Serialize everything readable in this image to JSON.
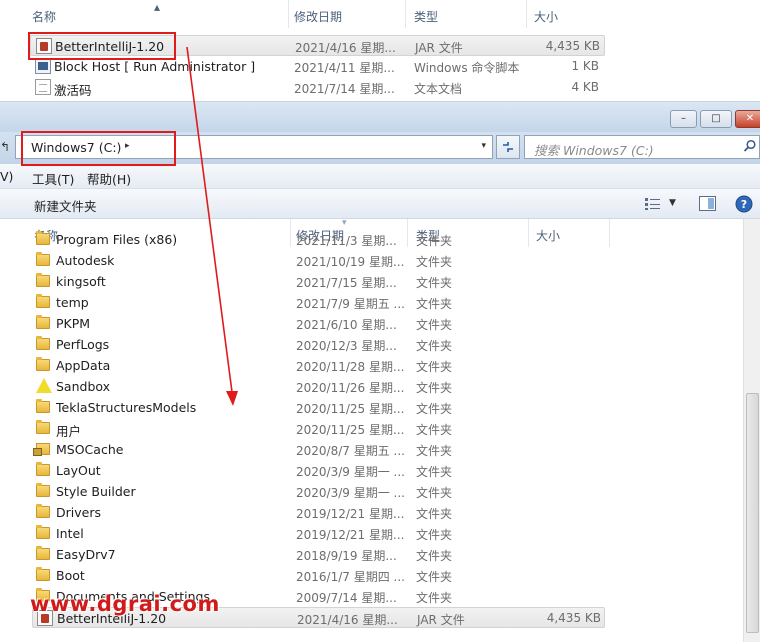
{
  "top_pane": {
    "columns": {
      "name": "名称",
      "date": "修改日期",
      "type": "类型",
      "size": "大小"
    },
    "files": [
      {
        "name": "BetterIntelliJ-1.20",
        "date": "2021/4/16 星期...",
        "type": "JAR 文件",
        "size": "4,435 KB",
        "icon": "jar-file-icon",
        "selected": true
      },
      {
        "name": "Block Host [ Run Administrator ]",
        "date": "2021/4/11 星期...",
        "type": "Windows 命令脚本",
        "size": "1 KB",
        "icon": "batch-file-icon"
      },
      {
        "name": "激活码",
        "date": "2021/7/14 星期...",
        "type": "文本文档",
        "size": "4 KB",
        "icon": "text-file-icon"
      }
    ]
  },
  "window": {
    "address": {
      "left_stub": "↰",
      "crumb": "Windows7 (C:)",
      "caret": "▸",
      "dropdown": "▾"
    },
    "refresh_icon": "refresh-icon",
    "search": {
      "placeholder": "搜索 Windows7 (C:)"
    },
    "menu": {
      "view_partial": "V)",
      "tools": "工具(T)",
      "help": "帮助(H)"
    },
    "toolbar": {
      "new_folder": "新建文件夹"
    },
    "caption_buttons": {
      "minimize": "–",
      "maximize": "□",
      "close": "✕"
    }
  },
  "list": {
    "columns": {
      "name": "名称",
      "date": "修改日期",
      "type": "类型",
      "size": "大小"
    },
    "items": [
      {
        "name": "Program Files (x86)",
        "date": "2021/11/3 星期...",
        "type": "文件夹",
        "icon": "folder"
      },
      {
        "name": "Autodesk",
        "date": "2021/10/19 星期...",
        "type": "文件夹",
        "icon": "folder"
      },
      {
        "name": "kingsoft",
        "date": "2021/7/15 星期...",
        "type": "文件夹",
        "icon": "folder"
      },
      {
        "name": "temp",
        "date": "2021/7/9 星期五 ...",
        "type": "文件夹",
        "icon": "folder"
      },
      {
        "name": "PKPM",
        "date": "2021/6/10 星期...",
        "type": "文件夹",
        "icon": "folder"
      },
      {
        "name": "PerfLogs",
        "date": "2020/12/3 星期...",
        "type": "文件夹",
        "icon": "folder"
      },
      {
        "name": "AppData",
        "date": "2020/11/28 星期...",
        "type": "文件夹",
        "icon": "folder"
      },
      {
        "name": "Sandbox",
        "date": "2020/11/26 星期...",
        "type": "文件夹",
        "icon": "sandbox"
      },
      {
        "name": "TeklaStructuresModels",
        "date": "2020/11/25 星期...",
        "type": "文件夹",
        "icon": "folder"
      },
      {
        "name": "用户",
        "date": "2020/11/25 星期...",
        "type": "文件夹",
        "icon": "folder"
      },
      {
        "name": "MSOCache",
        "date": "2020/8/7 星期五 ...",
        "type": "文件夹",
        "icon": "lockfolder"
      },
      {
        "name": "LayOut",
        "date": "2020/3/9 星期一 ...",
        "type": "文件夹",
        "icon": "folder"
      },
      {
        "name": "Style Builder",
        "date": "2020/3/9 星期一 ...",
        "type": "文件夹",
        "icon": "folder"
      },
      {
        "name": "Drivers",
        "date": "2019/12/21 星期...",
        "type": "文件夹",
        "icon": "folder"
      },
      {
        "name": "Intel",
        "date": "2019/12/21 星期...",
        "type": "文件夹",
        "icon": "folder"
      },
      {
        "name": "EasyDrv7",
        "date": "2018/9/19 星期...",
        "type": "文件夹",
        "icon": "folder"
      },
      {
        "name": "Boot",
        "date": "2016/1/7 星期四 ...",
        "type": "文件夹",
        "icon": "folder"
      },
      {
        "name": "Documents and Settings",
        "date": "2009/7/14 星期...",
        "type": "文件夹",
        "icon": "folder"
      },
      {
        "name": "BetterIntelliJ-1.20",
        "date": "2021/4/16 星期...",
        "type": "JAR 文件",
        "size": "4,435 KB",
        "icon": "jar",
        "selected": true
      }
    ]
  },
  "watermark": "www.dgrai.com",
  "annotation_color": "#e01b1b"
}
